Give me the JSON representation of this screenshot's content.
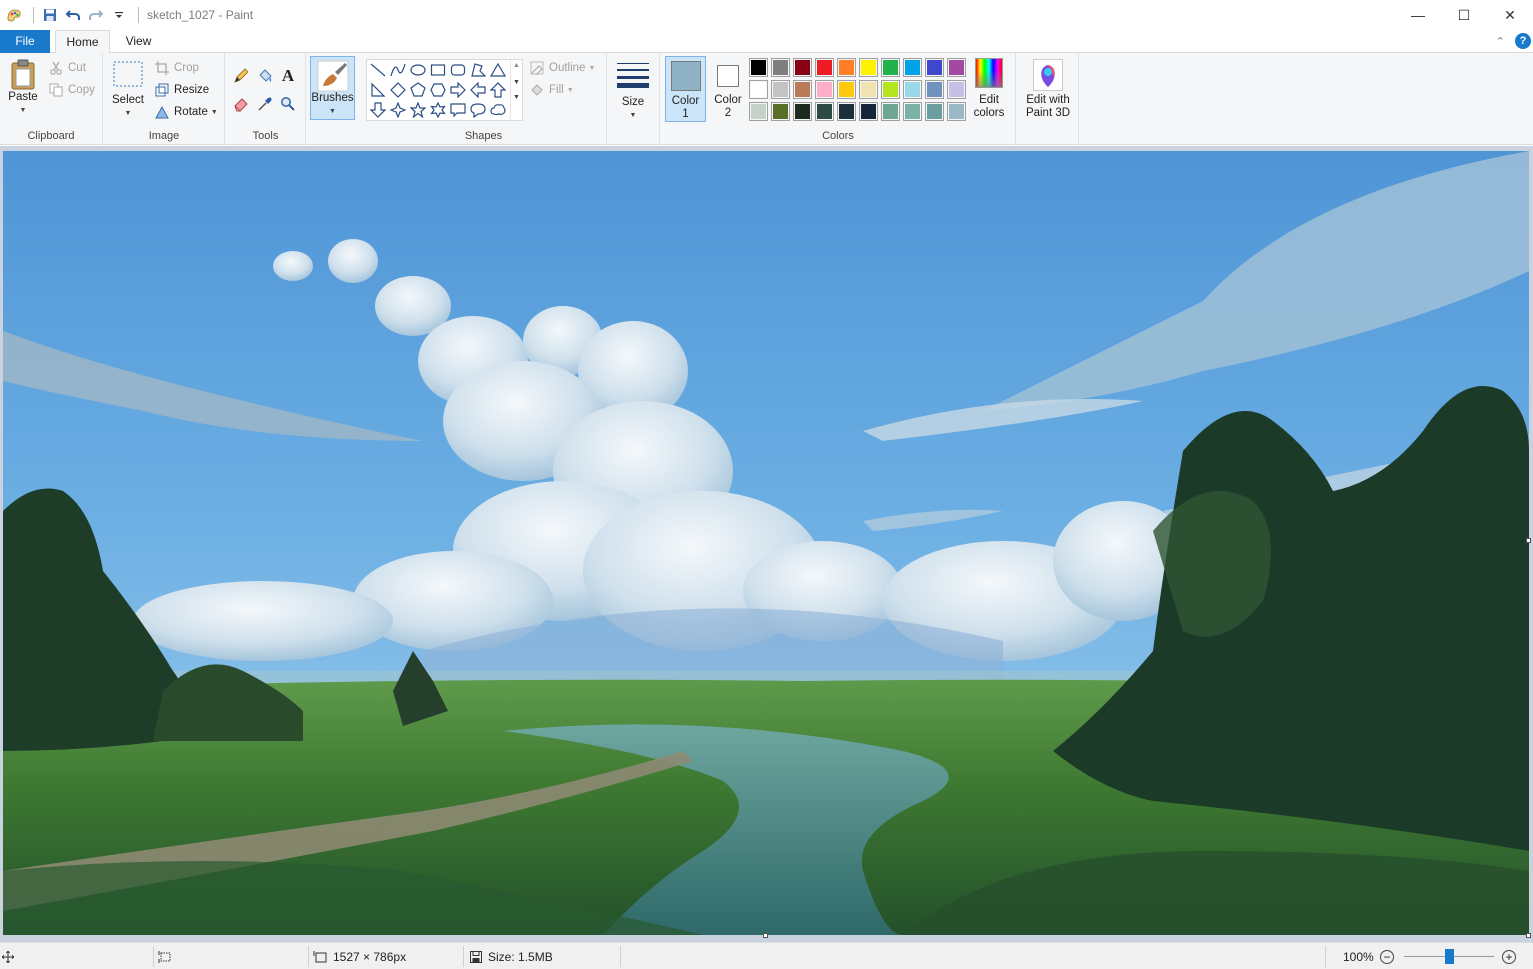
{
  "window": {
    "title": "sketch_1027 - Paint",
    "minimize_glyph": "—",
    "maximize_glyph": "☐",
    "close_glyph": "✕"
  },
  "tabs": {
    "file": "File",
    "home": "Home",
    "view": "View",
    "help_glyph": "?",
    "collapse_glyph": "⌃"
  },
  "ribbon": {
    "clipboard": {
      "label": "Clipboard",
      "paste": "Paste",
      "cut": "Cut",
      "copy": "Copy"
    },
    "image": {
      "label": "Image",
      "select": "Select",
      "crop": "Crop",
      "resize": "Resize",
      "rotate": "Rotate"
    },
    "tools": {
      "label": "Tools",
      "text_glyph": "A"
    },
    "brushes": {
      "label": "Brushes"
    },
    "shapes": {
      "label": "Shapes",
      "outline": "Outline",
      "fill": "Fill"
    },
    "size": {
      "label": "Size"
    },
    "colors": {
      "label": "Colors",
      "color1_line1": "Color",
      "color1_line2": "1",
      "color2_line1": "Color",
      "color2_line2": "2",
      "color1_value": "#8fb1c4",
      "color2_value": "#ffffff",
      "edit_line1": "Edit",
      "edit_line2": "colors",
      "palette": [
        [
          "#000000",
          "#7f7f7f",
          "#880015",
          "#ed1c24",
          "#ff7f27",
          "#fff200",
          "#22b14c",
          "#00a2e8",
          "#3f48cc",
          "#a349a4"
        ],
        [
          "#ffffff",
          "#c3c3c3",
          "#b97a57",
          "#ffaec9",
          "#ffc90e",
          "#efe4b0",
          "#b5e61d",
          "#99d9ea",
          "#7092be",
          "#c8bfe7"
        ],
        [
          "#c4d2c8",
          "#5a6e2a",
          "#1d2a1e",
          "#2a4a43",
          "#1b2f3b",
          "#152639",
          "#6ea595",
          "#7cb1a8",
          "#6c9ea0",
          "#9bb9c4"
        ]
      ]
    },
    "paint3d": {
      "line1": "Edit with",
      "line2": "Paint 3D"
    }
  },
  "status": {
    "dimensions": "1527 × 786px",
    "size": "Size: 1.5MB",
    "zoom": "100%",
    "zoom_level": 1.0,
    "minus_glyph": "−",
    "plus_glyph": "+"
  },
  "colors": {
    "accent": "#1979ca",
    "ribbon_bg": "#f5f6f7",
    "canvas_bg": "#c9d2de"
  }
}
